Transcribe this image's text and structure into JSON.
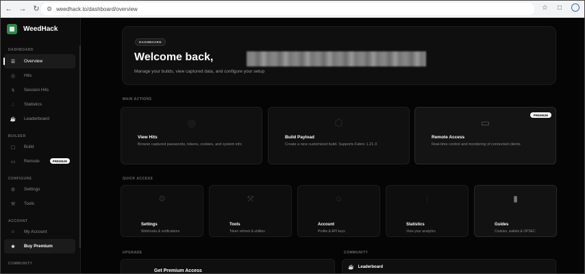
{
  "browser": {
    "url": "weedhack.to/dashboard/overview"
  },
  "sidebar": {
    "brand": "WeedHack",
    "sections": {
      "dashboard": "DASHBOARD",
      "builder": "BUILDER",
      "configure": "CONFIGURE",
      "account": "ACCOUNT",
      "community": "COMMUNITY"
    },
    "items": {
      "overview": "Overview",
      "hits": "Hits",
      "session_hits": "Session Hits",
      "statistics": "Statistics",
      "leaderboard": "Leaderboard",
      "build": "Build",
      "remote": "Remote",
      "remote_badge": "PREMIUM",
      "settings": "Settings",
      "tools": "Tools",
      "my_account": "My Account",
      "buy_premium": "Buy Premium"
    }
  },
  "hero": {
    "badge": "DASHBOARD",
    "title": "Welcome back,",
    "subtitle": "Manage your builds, view captured data, and configure your setup"
  },
  "main_actions": {
    "label": "MAIN ACTIONS",
    "cards": [
      {
        "title": "View Hits",
        "desc": "Browse captured passwords, tokens, cookies, and system info",
        "icon": "target-icon"
      },
      {
        "title": "Build Payload",
        "desc": "Create a new customized build. Supports Fabric 1.21.X",
        "icon": "package-icon"
      },
      {
        "title": "Remote Access",
        "desc": "Real-time control and monitoring of connected clients",
        "icon": "monitor-icon",
        "badge": "PREMIUM"
      }
    ]
  },
  "quick_access": {
    "label": "QUICK ACCESS",
    "cards": [
      {
        "title": "Settings",
        "desc": "Webhooks & notifications",
        "icon": "gear-icon"
      },
      {
        "title": "Tools",
        "desc": "Token refresh & utilities",
        "icon": "wrench-icon"
      },
      {
        "title": "Account",
        "desc": "Profile & API keys",
        "icon": "user-icon"
      },
      {
        "title": "Statistics",
        "desc": "View your analytics",
        "icon": "bar-chart-icon"
      },
      {
        "title": "Guides",
        "desc": "Cookies, wallets & OPSEC",
        "icon": "book-icon"
      }
    ]
  },
  "upgrade": {
    "label": "UPGRADE",
    "title": "Get Premium Access"
  },
  "community": {
    "label": "COMMUNITY",
    "leaderboard": "Leaderboard"
  }
}
